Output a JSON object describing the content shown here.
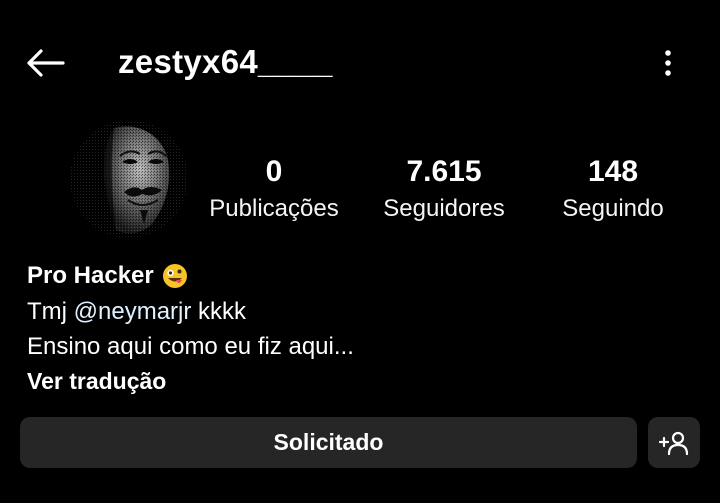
{
  "header": {
    "username": "zestyx64____",
    "back_icon": "arrow-left-icon",
    "more_icon": "more-vertical-icon"
  },
  "profile": {
    "avatar_icon": "anonymous-mask-avatar",
    "stats": [
      {
        "value": "0",
        "label": "Publicações"
      },
      {
        "value": "7.615",
        "label": "Seguidores"
      },
      {
        "value": "148",
        "label": "Seguindo"
      }
    ]
  },
  "bio": {
    "name": "Pro Hacker",
    "name_emoji_icon": "zany-face-emoji",
    "line1_prefix": "Tmj ",
    "line1_mention": "@neymarjr",
    "line1_suffix": " kkkk",
    "line2": "Ensino aqui como eu fiz aqui...",
    "translate_label": "Ver tradução"
  },
  "actions": {
    "requested_label": "Solicitado",
    "add_user_icon": "add-user-icon"
  },
  "colors": {
    "background": "#000000",
    "button_bg": "#262626",
    "text": "#ffffff",
    "mention": "#e0f1ff"
  }
}
